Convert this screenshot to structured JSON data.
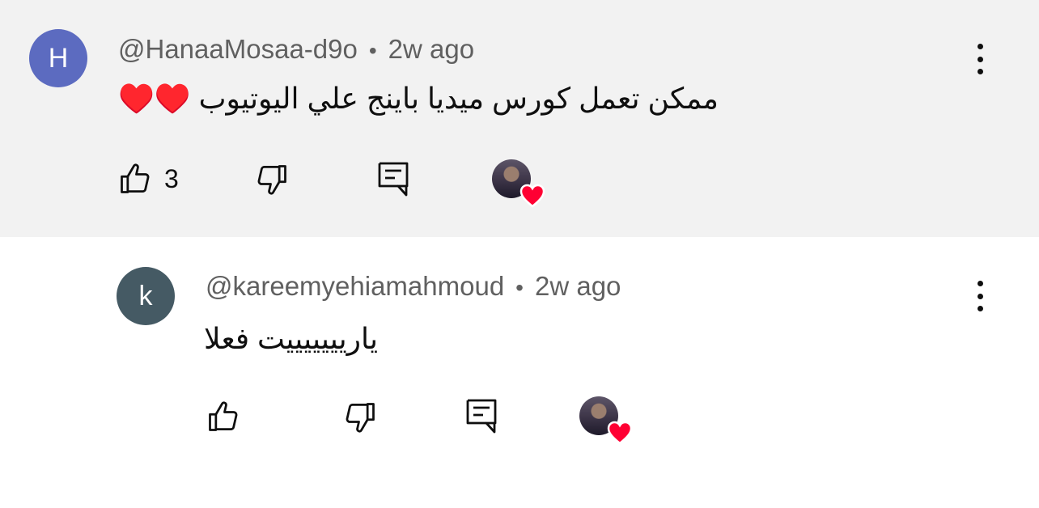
{
  "comments": [
    {
      "avatar_letter": "H",
      "avatar_color": "#5c6bc0",
      "username": "@HanaaMosaa-d9o",
      "separator": "•",
      "time": "2w ago",
      "text": "ممكن تعمل كورس ميديا باينج علي اليوتيوب ♥️♥️",
      "like_count": "3",
      "icons": {
        "like": "thumbs-up-icon",
        "dislike": "thumbs-down-icon",
        "reply": "reply-icon",
        "more": "more-vert-icon",
        "creator_heart": "creator-heart-icon"
      }
    },
    {
      "avatar_letter": "k",
      "avatar_color": "#455a64",
      "username": "@kareemyehiamahmoud",
      "separator": "•",
      "time": "2w ago",
      "text": "ياريييييييت فعلا",
      "like_count": "",
      "icons": {
        "like": "thumbs-up-icon",
        "dislike": "thumbs-down-icon",
        "reply": "reply-icon",
        "more": "more-vert-icon",
        "creator_heart": "creator-heart-icon"
      }
    }
  ],
  "colors": {
    "highlight_background": "#f2f2f2",
    "heart": "#ff0033",
    "meta_text": "#606060"
  }
}
